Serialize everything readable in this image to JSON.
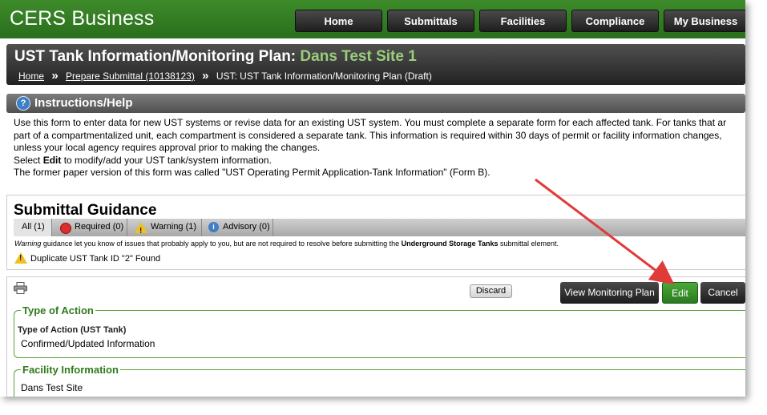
{
  "app": {
    "brand": "CERS Business",
    "nav": [
      "Home",
      "Submittals",
      "Facilities",
      "Compliance",
      "My Business"
    ]
  },
  "page_header": {
    "title_prefix": "UST Tank Information/Monitoring Plan:",
    "site_name": "Dans Test Site 1",
    "breadcrumb": {
      "home": "Home",
      "prepare": "Prepare Submittal (10138123)",
      "current": "UST: UST Tank Information/Monitoring Plan (Draft)",
      "separator": "»"
    }
  },
  "instructions": {
    "title": "Instructions/Help",
    "line1": "Use this form to enter data for new UST systems or revise data for an existing UST system. You must complete a separate form for each affected tank. For tanks that ar",
    "line2": "part of a compartmentalized unit, each compartment is considered a separate tank. This information is required within 30 days of permit or facility information changes,",
    "line3": "unless your local agency requires approval prior to making the changes.",
    "line4_pre": "Select ",
    "line4_bold": "Edit",
    "line4_post": " to modify/add your UST tank/system information.",
    "line5": "The former paper version of this form was called \"UST Operating Permit Application-Tank Information\" (Form B)."
  },
  "guidance": {
    "title": "Submittal Guidance",
    "tabs": {
      "all": "All (1)",
      "required": "Required (0)",
      "warning": "Warning (1)",
      "advisory": "Advisory (0)"
    },
    "note_italic": "Warning",
    "note_mid": " guidance let you know of issues that probably apply to you, but are not required to resolve before submitting the ",
    "note_bold": "Underground Storage Tanks",
    "note_end": " submittal element.",
    "item": "Duplicate UST Tank ID \"2\" Found"
  },
  "form": {
    "buttons": {
      "discard": "Discard",
      "view_monitoring": "View Monitoring Plan",
      "edit": "Edit",
      "cancel": "Cancel"
    },
    "type_of_action": {
      "legend": "Type of Action",
      "label": "Type of Action (UST Tank)",
      "value": "Confirmed/Updated Information"
    },
    "facility_information": {
      "legend": "Facility Information",
      "partial_value": "Dans Test Site"
    }
  },
  "colors": {
    "brand_green": "#2f7a20",
    "site_name": "#9acd7a",
    "annotation_arrow": "#e03a3a"
  }
}
